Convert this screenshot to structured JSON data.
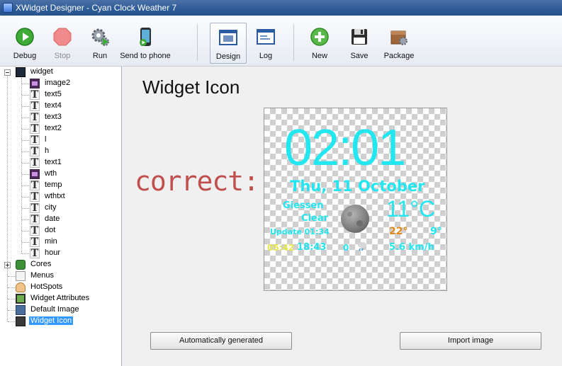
{
  "window": {
    "title": "XWidget Designer - Cyan Clock Weather 7"
  },
  "toolbar": {
    "debug": "Debug",
    "stop": "Stop",
    "run": "Run",
    "send_to_phone": "Send to phone",
    "design": "Design",
    "log": "Log",
    "new": "New",
    "save": "Save",
    "package": "Package"
  },
  "tree": {
    "root": "widget",
    "children": [
      "image2",
      "text5",
      "text4",
      "text3",
      "text2",
      "l",
      "h",
      "text1",
      "wth",
      "temp",
      "wthtxt",
      "city",
      "date",
      "dot",
      "min",
      "hour"
    ],
    "cores": "Cores",
    "menus": "Menus",
    "hotspots": "HotSpots",
    "widget_attributes": "Widget Attributes",
    "default_image": "Default Image",
    "widget_icon": "Widget Icon"
  },
  "main": {
    "title": "Widget Icon",
    "annotation": "correct:",
    "auto_button": "Automatically generated",
    "import_button": "Import image"
  },
  "preview": {
    "clock": "02:01",
    "date": "Thu, 11 October",
    "city": "Giessen",
    "condition": "Clear",
    "update": "Update 01:34",
    "temp": "11°C",
    "high": "22°",
    "low": "9°",
    "sunrise": "05:42",
    "sunset": "18:43",
    "rain": "0",
    "wind": "5.6 km/h"
  },
  "colors": {
    "accent": "#22e6f0",
    "high_temp": "#e58a1a",
    "annotation": "#c0504d",
    "selection": "#3399ff"
  }
}
